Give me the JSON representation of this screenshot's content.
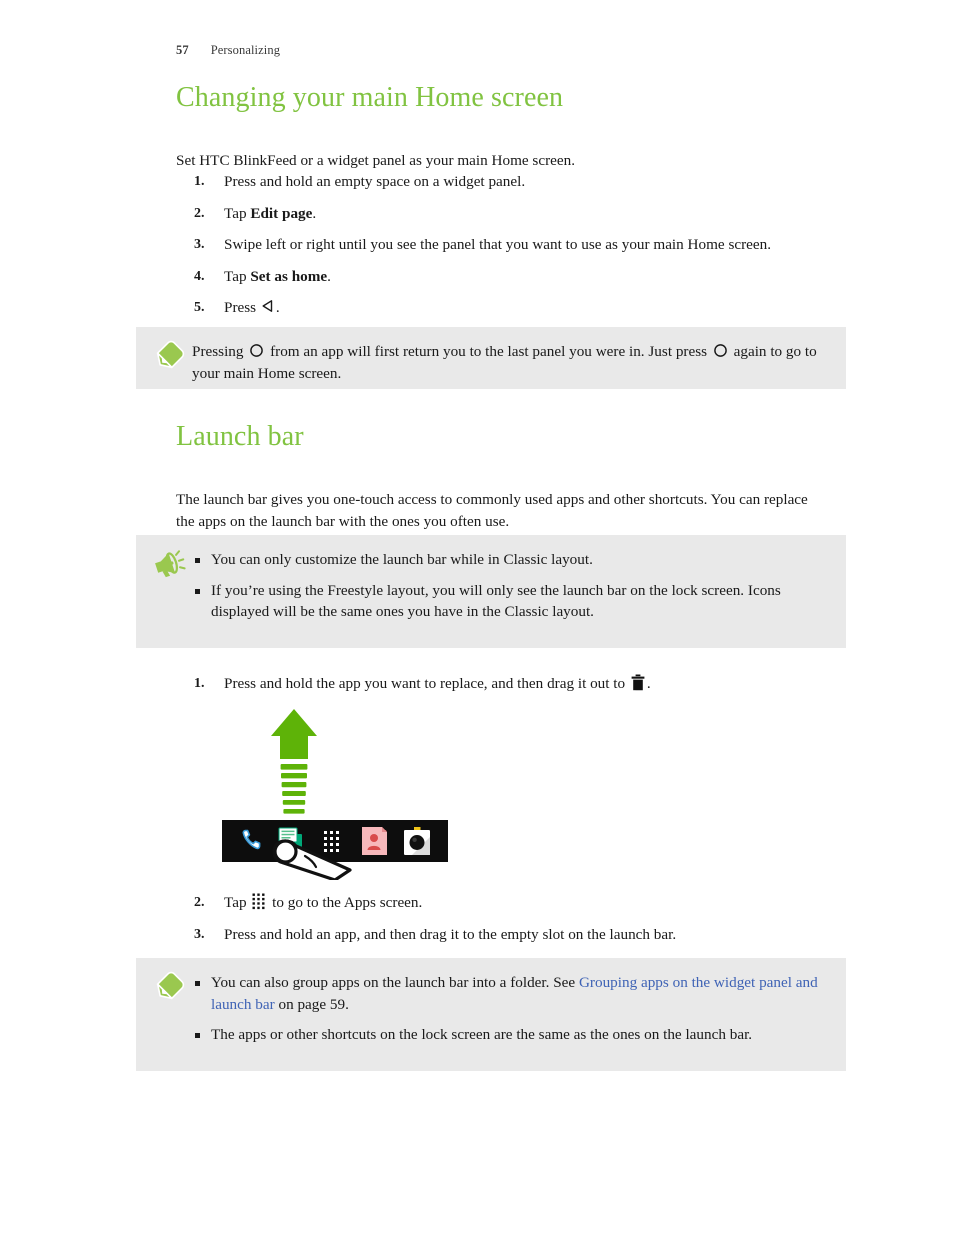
{
  "header": {
    "page_number": "57",
    "section": "Personalizing"
  },
  "sections": [
    {
      "id": "changing-main-home-screen",
      "heading": "Changing your main Home screen",
      "intro": "Set HTC BlinkFeed or a widget panel as your main Home screen."
    },
    {
      "id": "launch-bar",
      "heading": "Launch bar",
      "intro": "The launch bar gives you one-touch access to commonly used apps and other shortcuts. You can replace the apps on the launch bar with the ones you often use."
    }
  ],
  "steps_home_screen": [
    {
      "num": "1.",
      "pre": "Press and hold an empty space on a widget panel.",
      "bold": "",
      "post": ""
    },
    {
      "num": "2.",
      "pre": "Tap ",
      "bold": "Edit page",
      "post": "."
    },
    {
      "num": "3.",
      "pre": "Swipe left or right until you see the panel that you want to use as your main Home screen.",
      "bold": "",
      "post": ""
    },
    {
      "num": "4.",
      "pre": "Tap ",
      "bold": "Set as home",
      "post": "."
    },
    {
      "num": "5.",
      "pre": "Press ",
      "bold": "",
      "post": ".",
      "icon": "back-arrow-icon"
    }
  ],
  "note_home_screen": {
    "icon": "pencil-note-icon",
    "text_part1": "Pressing ",
    "icon_1": "home-circle-icon",
    "text_part2": " from an app will first return you to the last panel you were in. Just press ",
    "icon_2": "home-circle-icon",
    "text_part3": " again to go to your main Home screen."
  },
  "note_launch_bar": {
    "icon": "megaphone-icon",
    "bullets": [
      "You can only customize the launch bar while in Classic layout.",
      "If you’re using the Freestyle layout, you will only see the launch bar on the lock screen. Icons displayed will be the same ones you have in the Classic layout."
    ]
  },
  "steps_launch_bar_1": [
    {
      "num": "1.",
      "pre": "Press and hold the app you want to replace, and then drag it out to ",
      "post": ".",
      "icon": "trash-icon"
    }
  ],
  "steps_launch_bar_2": [
    {
      "num": "2.",
      "pre": "Tap ",
      "post": " to go to the Apps screen.",
      "icon": "apps-grid-icon"
    },
    {
      "num": "3.",
      "pre": "Press and hold an app, and then drag it to the empty slot on the launch bar.",
      "post": "",
      "icon": ""
    }
  ],
  "note_grouping": {
    "icon": "pencil-note-icon",
    "bullets": [
      {
        "pre": "You can also group apps on the launch bar into a folder. See ",
        "link": "Grouping apps on the widget panel and launch bar",
        "post": " on page 59."
      },
      {
        "pre": "The apps or other shortcuts on the lock screen are the same as the ones on the launch bar.",
        "link": "",
        "post": ""
      }
    ]
  },
  "illustration": {
    "name": "launch-bar-drag-illustration",
    "arrow": "upward-drag-arrow",
    "launch_bar_apps": [
      "phone-icon",
      "messages-icon",
      "apps-grid-icon",
      "contacts-icon",
      "camera-icon"
    ],
    "pointer": "finger-tap-pointer"
  },
  "colors": {
    "heading_green": "#81c341",
    "note_background": "#e9e9e9",
    "link_blue": "#3f63b5",
    "text": "#1a1a1a",
    "launch_bar_black": "#0d0d0d"
  }
}
